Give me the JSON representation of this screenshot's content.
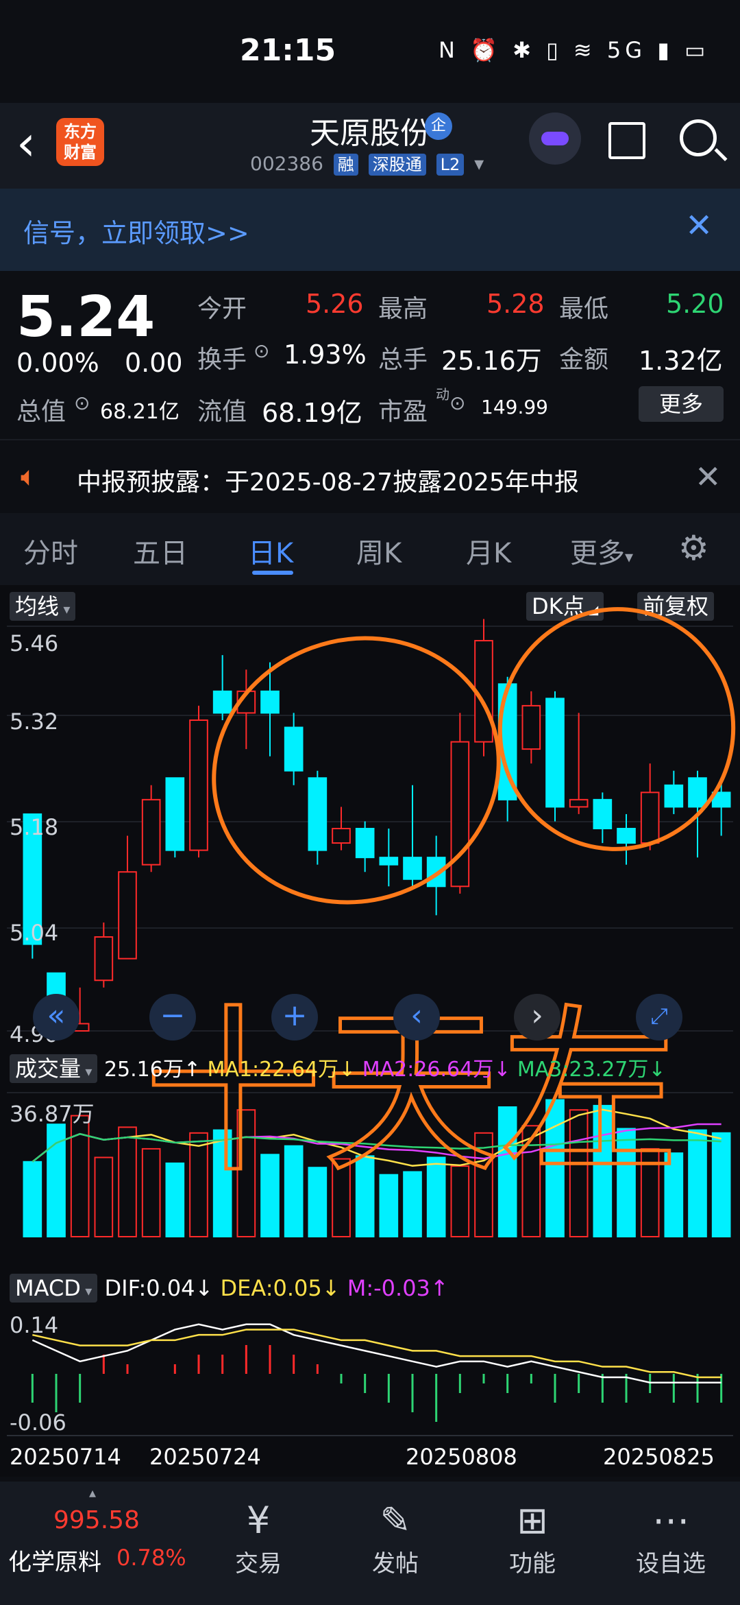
{
  "status": {
    "time": "21:15",
    "icons": "N ⏰ ✱ ▯ ≋ 5G ▮ ▭"
  },
  "header": {
    "back_icon": "back-arrow-icon",
    "logo_text": "东方财富",
    "stock_name": "天原股份",
    "qi_badge": "企",
    "code": "002386",
    "tags": [
      "融",
      "深股通",
      "L2"
    ]
  },
  "banner": {
    "text": "信号，立即领取>>",
    "close": "✕"
  },
  "quote": {
    "price": "5.24",
    "change_pct": "0.00%",
    "change_abs": "0.00",
    "rows": [
      [
        {
          "label": "今开",
          "value": "5.26",
          "color": "red"
        },
        {
          "label": "最高",
          "value": "5.28",
          "color": "red"
        },
        {
          "label": "最低",
          "value": "5.20",
          "color": "green"
        }
      ],
      [
        {
          "label": "换手",
          "value": "1.93%",
          "color": "white"
        },
        {
          "label": "总手",
          "value": "25.16万",
          "color": "white"
        },
        {
          "label": "金额",
          "value": "1.32亿",
          "color": "white"
        }
      ]
    ],
    "mkt_cap_label": "总值",
    "mkt_cap_value": "68.21亿",
    "float_label": "流值",
    "float_value": "68.19亿",
    "pe_label": "市盈",
    "pe_sup": "动",
    "pe_value": "149.99",
    "more": "更多"
  },
  "notice": {
    "text": "中报预披露：于2025-08-27披露2025年中报",
    "close": "✕"
  },
  "tabs": {
    "items": [
      "分时",
      "五日",
      "日K",
      "周K",
      "月K",
      "更多"
    ],
    "active": 2
  },
  "chart": {
    "ma_chip": "均线",
    "dk_chip": "DK点",
    "adj_chip": "前复权",
    "price_ticks": [
      "5.46",
      "5.32",
      "5.18",
      "5.04",
      "4.90"
    ],
    "vol_chip": "成交量",
    "vol_value": "25.16万↑",
    "ma1": "MA1:22.64万↓",
    "ma2": "MA2:26.64万↓",
    "ma3": "MA3:23.27万↓",
    "vol_max": "36.87万",
    "macd_chip": "MACD",
    "dif": "DIF:0.04↓",
    "dea": "DEA:0.05↓",
    "m": "M:-0.03↑",
    "macd_ticks": [
      "0.14",
      "-0.06"
    ],
    "dates": [
      "20250714",
      "20250724",
      "20250808",
      "20250825"
    ],
    "annotation_text": "十天左"
  },
  "chart_data": {
    "type": "candlestick",
    "ylim": [
      4.9,
      5.46
    ],
    "candles": [
      {
        "o": 5.2,
        "c": 5.02,
        "h": 5.2,
        "l": 5.0
      },
      {
        "o": 4.98,
        "c": 4.93,
        "h": 4.98,
        "l": 4.89
      },
      {
        "o": 4.9,
        "c": 4.91,
        "h": 4.96,
        "l": 4.9
      },
      {
        "o": 4.97,
        "c": 5.03,
        "h": 5.05,
        "l": 4.96
      },
      {
        "o": 5.0,
        "c": 5.12,
        "h": 5.17,
        "l": 5.0
      },
      {
        "o": 5.13,
        "c": 5.22,
        "h": 5.24,
        "l": 5.12
      },
      {
        "o": 5.25,
        "c": 5.15,
        "h": 5.25,
        "l": 5.14
      },
      {
        "o": 5.15,
        "c": 5.33,
        "h": 5.35,
        "l": 5.14
      },
      {
        "o": 5.37,
        "c": 5.34,
        "h": 5.42,
        "l": 5.33
      },
      {
        "o": 5.34,
        "c": 5.37,
        "h": 5.4,
        "l": 5.29
      },
      {
        "o": 5.37,
        "c": 5.34,
        "h": 5.41,
        "l": 5.28
      },
      {
        "o": 5.32,
        "c": 5.26,
        "h": 5.34,
        "l": 5.24
      },
      {
        "o": 5.25,
        "c": 5.15,
        "h": 5.26,
        "l": 5.13
      },
      {
        "o": 5.16,
        "c": 5.18,
        "h": 5.21,
        "l": 5.15
      },
      {
        "o": 5.18,
        "c": 5.14,
        "h": 5.19,
        "l": 5.12
      },
      {
        "o": 5.14,
        "c": 5.13,
        "h": 5.18,
        "l": 5.1
      },
      {
        "o": 5.14,
        "c": 5.11,
        "h": 5.24,
        "l": 5.1
      },
      {
        "o": 5.14,
        "c": 5.1,
        "h": 5.17,
        "l": 5.06
      },
      {
        "o": 5.1,
        "c": 5.3,
        "h": 5.34,
        "l": 5.09
      },
      {
        "o": 5.3,
        "c": 5.44,
        "h": 5.47,
        "l": 5.28
      },
      {
        "o": 5.38,
        "c": 5.22,
        "h": 5.39,
        "l": 5.19
      },
      {
        "o": 5.29,
        "c": 5.35,
        "h": 5.37,
        "l": 5.27
      },
      {
        "o": 5.36,
        "c": 5.21,
        "h": 5.37,
        "l": 5.19
      },
      {
        "o": 5.21,
        "c": 5.22,
        "h": 5.34,
        "l": 5.2
      },
      {
        "o": 5.22,
        "c": 5.18,
        "h": 5.23,
        "l": 5.16
      },
      {
        "o": 5.18,
        "c": 5.16,
        "h": 5.2,
        "l": 5.13
      },
      {
        "o": 5.16,
        "c": 5.23,
        "h": 5.27,
        "l": 5.15
      },
      {
        "o": 5.24,
        "c": 5.21,
        "h": 5.26,
        "l": 5.2
      },
      {
        "o": 5.25,
        "c": 5.21,
        "h": 5.26,
        "l": 5.14
      },
      {
        "o": 5.23,
        "c": 5.21,
        "h": 5.25,
        "l": 5.17
      }
    ],
    "volume": [
      0.52,
      0.78,
      0.84,
      0.55,
      0.76,
      0.61,
      0.51,
      0.72,
      0.74,
      0.88,
      0.57,
      0.63,
      0.48,
      0.54,
      0.56,
      0.43,
      0.45,
      0.55,
      0.49,
      0.72,
      0.9,
      0.77,
      0.95,
      0.88,
      0.91,
      0.75,
      0.61,
      0.58,
      0.74,
      0.72
    ],
    "macd": [
      -0.03,
      -0.04,
      -0.03,
      0.02,
      0.01,
      0.0,
      0.01,
      0.02,
      0.02,
      0.03,
      0.03,
      0.02,
      0.01,
      -0.01,
      -0.02,
      -0.03,
      -0.04,
      -0.05,
      -0.02,
      -0.01,
      -0.02,
      -0.01,
      -0.03,
      -0.02,
      -0.03,
      -0.03,
      -0.02,
      -0.03,
      -0.03,
      -0.03
    ]
  },
  "bottom": {
    "index_value": "995.58",
    "index_name": "化学原料",
    "index_change": "0.78%",
    "nav": [
      {
        "label": "交易",
        "icon": "yuan-icon"
      },
      {
        "label": "发帖",
        "icon": "edit-icon"
      },
      {
        "label": "功能",
        "icon": "grid-icon"
      },
      {
        "label": "设自选",
        "icon": "more-dots-icon"
      }
    ]
  }
}
